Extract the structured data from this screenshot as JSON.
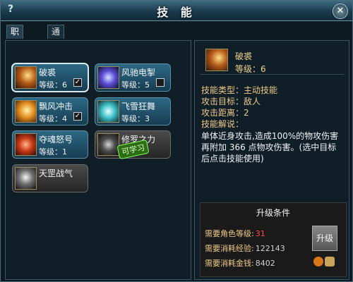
{
  "window": {
    "title": "技 能"
  },
  "tabs": [
    {
      "label": "职业技能",
      "active": true
    },
    {
      "label": "通用技能",
      "active": false
    }
  ],
  "skills": [
    {
      "name": "破裘",
      "level_text": "等级：6",
      "checked": true,
      "icon": "sword-slash-icon",
      "style": "blue",
      "selected": true
    },
    {
      "name": "风驰电掣",
      "level_text": "等级：5",
      "checked": false,
      "icon": "lightning-icon",
      "style": "blue",
      "selected": false
    },
    {
      "name": "飘风冲击",
      "level_text": "等级：4",
      "checked": true,
      "icon": "wind-blade-icon",
      "style": "blue",
      "selected": false
    },
    {
      "name": "飞雪狂舞",
      "level_text": "等级：3",
      "checked": false,
      "icon": "snow-blade-icon",
      "style": "blue",
      "selected": false
    },
    {
      "name": "夺魂怒号",
      "level_text": "等级：1",
      "checked": false,
      "icon": "rage-icon",
      "style": "blue",
      "selected": false
    },
    {
      "name": "修罗之力",
      "level_text": "",
      "checked": false,
      "icon": "demon-icon",
      "style": "gray",
      "selected": false
    },
    {
      "name": "天罡战气",
      "level_text": "",
      "checked": false,
      "icon": "warrior-aura-icon",
      "style": "gray",
      "selected": false
    }
  ],
  "learnable_label": "可学习",
  "detail": {
    "icon": "sword-slash-icon",
    "name": "破裘",
    "level_text": "等级：6",
    "type_line": "技能类型：主动技能",
    "target_line": "攻击目标：敌人",
    "range_line": "攻击距离：2",
    "desc_label": "技能解说：",
    "desc_text": "单体近身攻击,造成100%的物攻伤害再附加 366 点物攻伤害。(选中目标后点击技能使用)"
  },
  "upgrade": {
    "title": "升级条件",
    "req_role_label": "需要角色等级:",
    "req_role_value": "31",
    "req_exp_label": "需要消耗经验:",
    "req_exp_value": "122143",
    "req_money_label": "需要消耗金钱:",
    "req_money_value": "8402",
    "button_label": "升级"
  },
  "colors": {
    "accent": "#f1d28b",
    "panel_bg": "#0f1e27",
    "skill_blue": "#2c6884",
    "skill_gray": "#4a4a4a",
    "learnable_green": "#2d6e14"
  }
}
